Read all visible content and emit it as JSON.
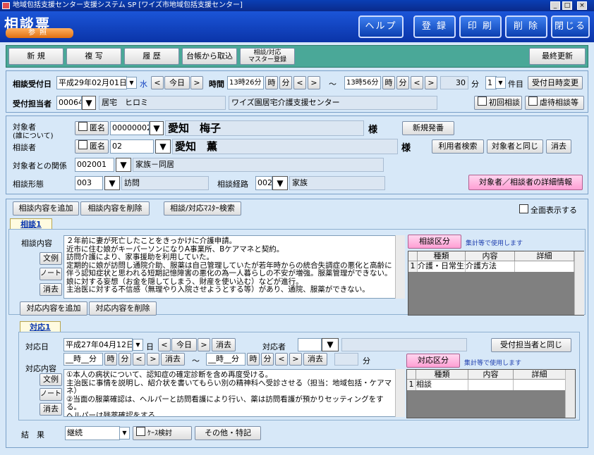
{
  "window": {
    "title": "地域包括支援センター支援システム SP [ワイズ市地域包括支援センター]"
  },
  "header": {
    "app_title": "相談票",
    "mode": "参照",
    "buttons": {
      "help": "ヘルプ",
      "register": "登 録",
      "print": "印 刷",
      "delete": "削 除",
      "close": "閉じる"
    }
  },
  "toolbar": {
    "new": "新 規",
    "copy": "複 写",
    "history": "履 歴",
    "from_ledger": "台帳から取込",
    "master_line1": "相談/対応",
    "master_line2": "マスター登録",
    "last_update": "最終更新"
  },
  "reception": {
    "date_label": "相談受付日",
    "date_value": "平成29年02月01日",
    "weekday": "水",
    "today": "今日",
    "time_label": "時間",
    "time_from": "13時26分",
    "time_to": "13時56分",
    "hour_btn": "時",
    "min_btn": "分",
    "tilde": "～",
    "duration": "30",
    "duration_unit": "分",
    "count": "1",
    "count_unit": "件目",
    "change_btn": "受付日時変更",
    "staff_label": "受付担当者",
    "staff_code": "00064",
    "staff_name": "居宅　ヒロミ",
    "office": "ワイズ園居宅介護支援センター",
    "first_consult": "初回相談",
    "abuse_consult": "虐待相談等"
  },
  "persons": {
    "target_label": "対象者",
    "target_sub": "(誰について)",
    "anon_label": "匿名",
    "target_code": "00000002",
    "target_name": "愛知　梅子",
    "honorific": "様",
    "new_issue_btn": "新規発番",
    "consulter_label": "相談者",
    "consulter_code": "02",
    "consulter_name": "愛知　薫",
    "user_search_btn": "利用者検索",
    "same_as_target_btn": "対象者と同じ",
    "clear_btn": "消去",
    "relation_label": "対象者との関係",
    "relation_code": "002001",
    "relation_text": "家族－同居",
    "form_label": "相談形態",
    "form_code": "003",
    "form_text": "訪問",
    "route_label": "相談経路",
    "route_code": "002",
    "route_text": "家族",
    "detail_btn": "対象者／相談者の詳細情報"
  },
  "consult": {
    "add_btn": "相談内容を追加",
    "del_btn": "相談内容を削除",
    "master_search_btn": "相談/対応ﾏｽﾀｰ検索",
    "show_all": "全面表示する",
    "tab": "相談1",
    "content_label": "相談内容",
    "example_btn": "文例",
    "note_btn": "ノート",
    "clear_btn": "消去",
    "content": "２年前に妻が死亡したことをきっかけに介護申請。\n近市に住む娘がキーパーソンになりA事業所、Bケアマネと契約。\n訪問介護により、家事援助を利用していた。\n定期的に娘が訪問し通院介助、服薬は自己管理していたが若年時からの統合失調症の悪化と高齢に伴う認知症状と思われる短期記憶障害の悪化の為一人暮らしの不安が増強。服薬管理ができない。\n娘に対する妄想（お金を隠してしまう、財産を使い込む）などが進行。\n主治医に対する不信感（無理やり入院させようとする等）があり、通院、服薬ができない。",
    "category_btn": "相談区分",
    "category_note": "集計等で使用します",
    "grid_headers": [
      "種類",
      "内容",
      "詳細"
    ],
    "grid_rows": [
      {
        "no": "1",
        "type": "介護・日常生活",
        "content": "介護方法",
        "detail": ""
      }
    ]
  },
  "response": {
    "add_btn": "対応内容を追加",
    "del_btn": "対応内容を削除",
    "tab": "対応1",
    "date_label": "対応日",
    "date_value": "平成27年04月12日",
    "weekday": "日",
    "today": "今日",
    "clear": "消去",
    "staff_label": "対応者",
    "same_staff_btn": "受付担当者と同じ",
    "content_label": "対応内容",
    "time_from": "__時__分",
    "time_to": "__時__分",
    "hour_btn": "時",
    "min_btn": "分",
    "tilde": "～",
    "min_unit": "分",
    "example_btn": "文例",
    "note_btn": "ノート",
    "clear_btn": "消去",
    "content": "①本人の病状について、認知症の確定診断を含め再度受ける。\n主治医に事情を説明し、紹介状を書いてもらい別の精神科へ受診させる（担当：地域包括・ケアマネ）\n②当面の服薬確認は、ヘルパーと訪問看護により行い、薬は訪問看護が預かりセッティングをする。\nヘルパーは残薬確認をする。",
    "category_btn": "対応区分",
    "category_note": "集計等で使用します",
    "grid_headers": [
      "種類",
      "内容",
      "詳細"
    ],
    "grid_rows": [
      {
        "no": "1",
        "type": "相談",
        "content": "",
        "detail": ""
      }
    ]
  },
  "result": {
    "label": "結　果",
    "value": "継続",
    "case_review": "ｹｰｽ検討",
    "other_btn": "その他・特記"
  }
}
